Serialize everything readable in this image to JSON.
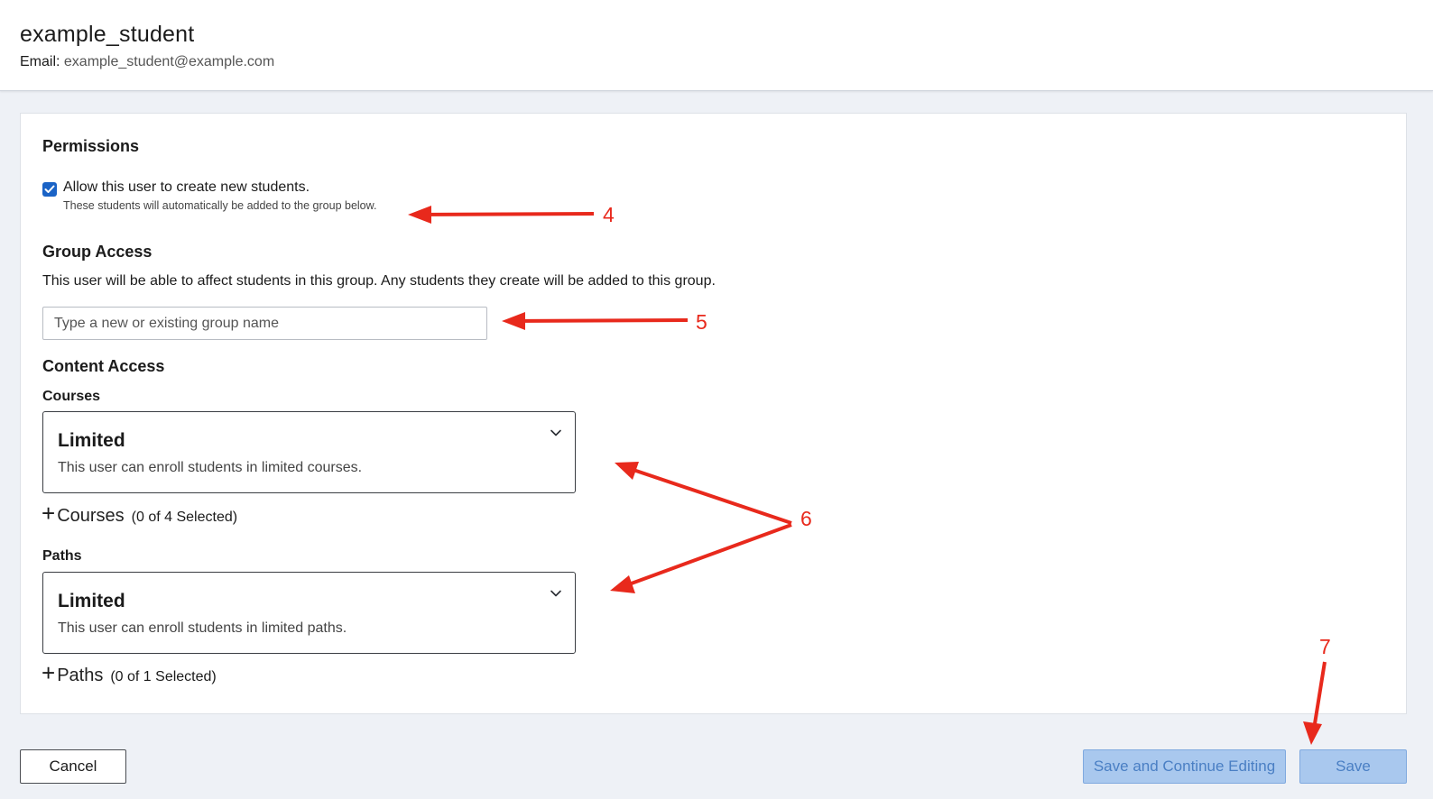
{
  "header": {
    "username": "example_student",
    "email_label": "Email:",
    "email_value": "example_student@example.com"
  },
  "permissions": {
    "title": "Permissions",
    "checkbox_checked": true,
    "checkbox_label": "Allow this user to create new students.",
    "checkbox_sublabel": "These students will automatically be added to the group below."
  },
  "group_access": {
    "title": "Group Access",
    "description": "This user will be able to affect students in this group. Any students they create will be added to this group.",
    "input_value": "",
    "input_placeholder": "Type a new or existing group name"
  },
  "content_access": {
    "title": "Content Access",
    "courses": {
      "label": "Courses",
      "select_value": "Limited",
      "select_description": "This user can enroll students in limited courses.",
      "add_icon": "plus-icon",
      "add_label": "Courses",
      "selected_count": "(0 of 4 Selected)"
    },
    "paths": {
      "label": "Paths",
      "select_value": "Limited",
      "select_description": "This user can enroll students in limited paths.",
      "add_icon": "plus-icon",
      "add_label": "Paths",
      "selected_count": "(0 of 1 Selected)"
    }
  },
  "footer": {
    "cancel_label": "Cancel",
    "save_continue_label": "Save and Continue Editing",
    "save_label": "Save"
  },
  "annotations": {
    "color": "#e8291c",
    "labels": [
      "4",
      "5",
      "6",
      "7"
    ]
  },
  "colors": {
    "accent": "#1a63c6",
    "button_disabled_bg": "#a9c8ee",
    "button_disabled_text": "#4a7fc4",
    "page_bg": "#eef1f6"
  }
}
